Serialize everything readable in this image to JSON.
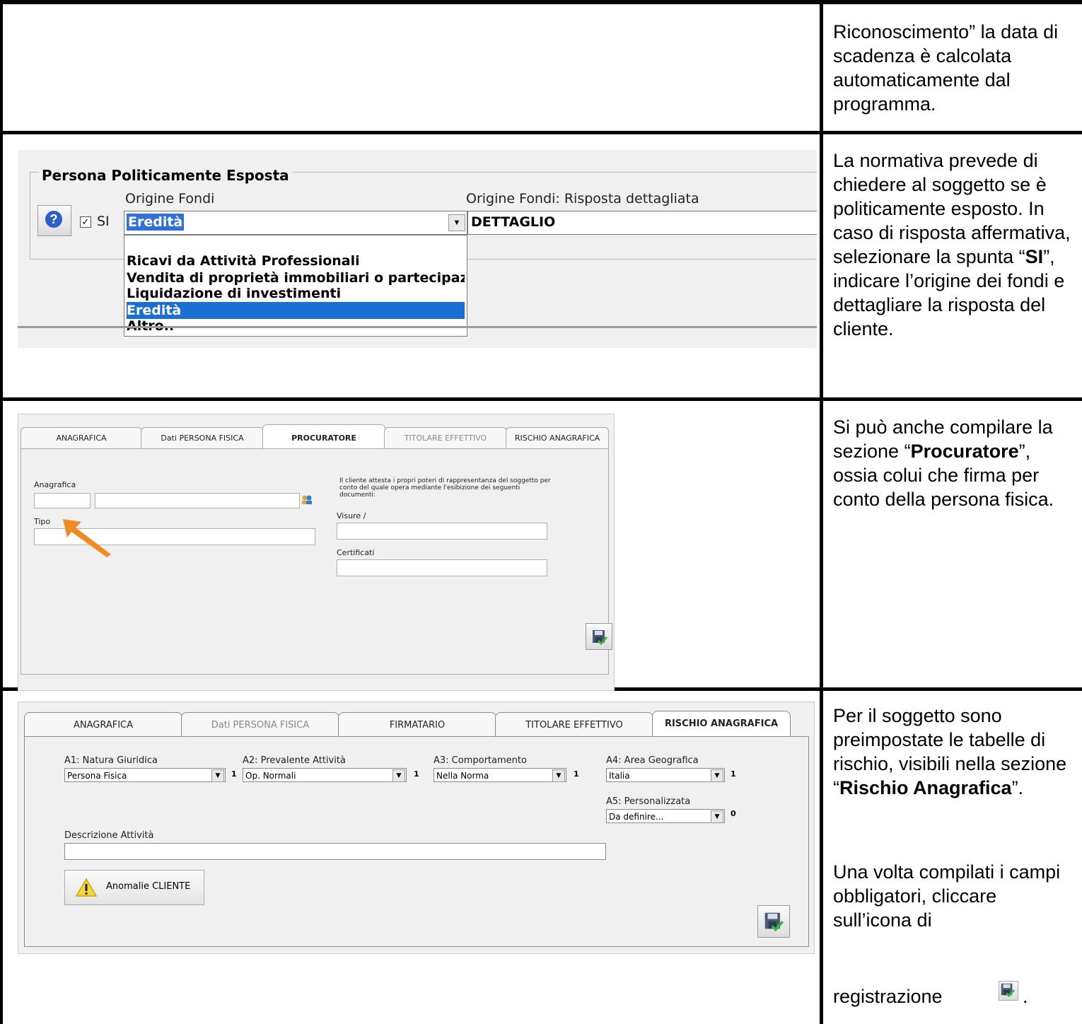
{
  "rows": [
    {
      "text": "Riconoscimento” la data di scadenza è calcolata automaticamente dal programma."
    },
    {
      "text_before": "La normativa prevede di chiedere al soggetto se è politicamente esposto. In caso di risposta affermativa, selezionare la spunta “",
      "bold": "SI",
      "text_after": "”, indicare l’origine dei fondi e dettagliare la risposta del cliente."
    },
    {
      "text_before": "Si può anche compilare la sezione “",
      "bold": "Procuratore",
      "text_after": "”, ossia colui che firma per conto della persona fisica."
    },
    {
      "text_before": "Per il soggetto sono preimpostate le tabelle di rischio, visibili nella sezione “",
      "bold": "Rischio Anagrafica",
      "text_after": "”.",
      "text2": "Una volta compilati i campi obbligatori, cliccare sull’icona di",
      "text3": "registrazione",
      "text3_after": "."
    }
  ],
  "pep": {
    "legend": "Persona Politicamente Esposta",
    "origine_label": "Origine Fondi",
    "dettaglio_label": "Origine Fondi: Risposta dettagliata",
    "si_label": "SI",
    "si_checked": true,
    "selected": "Eredità",
    "detail_value": "DETTAGLIO",
    "options": [
      "Ricavi da Attività Professionali",
      "Vendita di proprietà immobiliari o partecipazioni",
      "Liquidazione di investimenti",
      "Eredità",
      "Altro.."
    ]
  },
  "proc": {
    "tabs": [
      "ANAGRAFICA",
      "Dati PERSONA FISICA",
      "PROCURATORE",
      "TITOLARE EFFETTIVO",
      "RISCHIO ANAGRAFICA"
    ],
    "anagrafica_label": "Anagrafica",
    "tipo_label": "Tipo",
    "note": "Il cliente attesta i propri poteri di rappresentanza del soggetto per conto del quale opera mediante l'esibizione dei seguenti documenti:",
    "visure_label": "Visure /",
    "certificati_label": "Certificati"
  },
  "risk": {
    "tabs": [
      "ANAGRAFICA",
      "Dati PERSONA FISICA",
      "FIRMATARIO",
      "TITOLARE EFFETTIVO",
      "RISCHIO ANAGRAFICA"
    ],
    "fields": [
      {
        "label": "A1: Natura Giuridica",
        "value": "Persona Fisica",
        "score": "1"
      },
      {
        "label": "A2: Prevalente Attività",
        "value": "Op. Normali",
        "score": "1"
      },
      {
        "label": "A3: Comportamento",
        "value": "Nella Norma",
        "score": "1"
      },
      {
        "label": "A4: Area Geografica",
        "value": "Italia",
        "score": "1"
      },
      {
        "label": "A5: Personalizzata",
        "value": "Da definire...",
        "score": "0"
      }
    ],
    "descrizione_label": "Descrizione Attività",
    "anomalie_label": "Anomalie CLIENTE"
  },
  "icons": [
    "help-icon",
    "address-book-icon",
    "save-icon",
    "warning-icon",
    "arrow-icon"
  ],
  "colors": {
    "selection": "#1a6fd1",
    "arrow": "#f08a24"
  }
}
